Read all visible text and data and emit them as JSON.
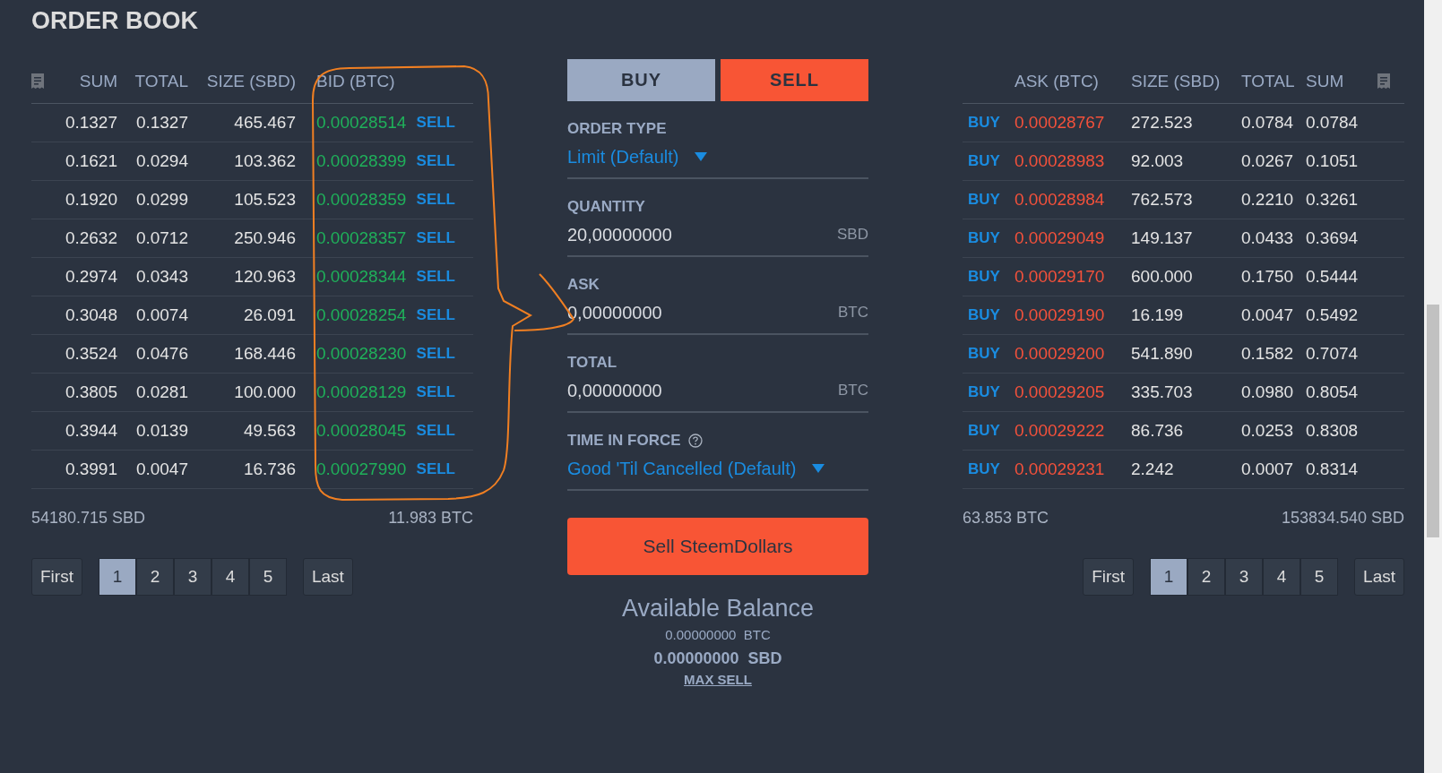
{
  "title": "ORDER BOOK",
  "bids": {
    "columns": [
      "SUM",
      "TOTAL",
      "SIZE (SBD)",
      "BID (BTC)"
    ],
    "rows": [
      {
        "sum": "0.1327",
        "total": "0.1327",
        "size": "465.467",
        "price": "0.00028514",
        "action": "SELL"
      },
      {
        "sum": "0.1621",
        "total": "0.0294",
        "size": "103.362",
        "price": "0.00028399",
        "action": "SELL"
      },
      {
        "sum": "0.1920",
        "total": "0.0299",
        "size": "105.523",
        "price": "0.00028359",
        "action": "SELL"
      },
      {
        "sum": "0.2632",
        "total": "0.0712",
        "size": "250.946",
        "price": "0.00028357",
        "action": "SELL"
      },
      {
        "sum": "0.2974",
        "total": "0.0343",
        "size": "120.963",
        "price": "0.00028344",
        "action": "SELL"
      },
      {
        "sum": "0.3048",
        "total": "0.0074",
        "size": "26.091",
        "price": "0.00028254",
        "action": "SELL"
      },
      {
        "sum": "0.3524",
        "total": "0.0476",
        "size": "168.446",
        "price": "0.00028230",
        "action": "SELL"
      },
      {
        "sum": "0.3805",
        "total": "0.0281",
        "size": "100.000",
        "price": "0.00028129",
        "action": "SELL"
      },
      {
        "sum": "0.3944",
        "total": "0.0139",
        "size": "49.563",
        "price": "0.00028045",
        "action": "SELL"
      },
      {
        "sum": "0.3991",
        "total": "0.0047",
        "size": "16.736",
        "price": "0.00027990",
        "action": "SELL"
      }
    ],
    "footer": [
      "54180.715 SBD",
      "11.983 BTC"
    ],
    "pagination": {
      "first": "First",
      "pages": [
        {
          "label": "1",
          "selected": true
        },
        {
          "label": "2",
          "selected": false
        },
        {
          "label": "3",
          "selected": false
        },
        {
          "label": "4",
          "selected": false
        },
        {
          "label": "5",
          "selected": false
        }
      ],
      "last": "Last"
    }
  },
  "order_form": {
    "tabs": [
      {
        "label": "BUY",
        "selected": false
      },
      {
        "label": "SELL",
        "selected": true
      }
    ],
    "fields": [
      {
        "kind": "select",
        "label": "ORDER TYPE",
        "value": "Limit (Default)",
        "help": false
      },
      {
        "kind": "input",
        "label": "QUANTITY",
        "value": "20,00000000",
        "unit": "SBD",
        "help": false
      },
      {
        "kind": "input",
        "label": "ASK",
        "value": "0,00000000",
        "unit": "BTC",
        "help": false
      },
      {
        "kind": "input",
        "label": "TOTAL",
        "value": "0,00000000",
        "unit": "BTC",
        "help": false
      },
      {
        "kind": "select",
        "label": "TIME IN FORCE",
        "value": "Good 'Til Cancelled (Default)",
        "help": true
      }
    ],
    "submit": "Sell SteemDollars",
    "balance": {
      "title": "Available Balance",
      "lines": [
        {
          "text": "0.00000000  BTC",
          "emphasis": false
        },
        {
          "text": "0.00000000  SBD",
          "emphasis": true
        }
      ],
      "link": "MAX SELL"
    }
  },
  "asks": {
    "columns": [
      "ASK (BTC)",
      "SIZE (SBD)",
      "TOTAL",
      "SUM"
    ],
    "rows": [
      {
        "action": "BUY",
        "price": "0.00028767",
        "size": "272.523",
        "total": "0.0784",
        "sum": "0.0784"
      },
      {
        "action": "BUY",
        "price": "0.00028983",
        "size": "92.003",
        "total": "0.0267",
        "sum": "0.1051"
      },
      {
        "action": "BUY",
        "price": "0.00028984",
        "size": "762.573",
        "total": "0.2210",
        "sum": "0.3261"
      },
      {
        "action": "BUY",
        "price": "0.00029049",
        "size": "149.137",
        "total": "0.0433",
        "sum": "0.3694"
      },
      {
        "action": "BUY",
        "price": "0.00029170",
        "size": "600.000",
        "total": "0.1750",
        "sum": "0.5444"
      },
      {
        "action": "BUY",
        "price": "0.00029190",
        "size": "16.199",
        "total": "0.0047",
        "sum": "0.5492"
      },
      {
        "action": "BUY",
        "price": "0.00029200",
        "size": "541.890",
        "total": "0.1582",
        "sum": "0.7074"
      },
      {
        "action": "BUY",
        "price": "0.00029205",
        "size": "335.703",
        "total": "0.0980",
        "sum": "0.8054"
      },
      {
        "action": "BUY",
        "price": "0.00029222",
        "size": "86.736",
        "total": "0.0253",
        "sum": "0.8308"
      },
      {
        "action": "BUY",
        "price": "0.00029231",
        "size": "2.242",
        "total": "0.0007",
        "sum": "0.8314"
      }
    ],
    "footer": [
      "63.853 BTC",
      "153834.540 SBD"
    ],
    "pagination": {
      "first": "First",
      "pages": [
        {
          "label": "1",
          "selected": true
        },
        {
          "label": "2",
          "selected": false
        },
        {
          "label": "3",
          "selected": false
        },
        {
          "label": "4",
          "selected": false
        },
        {
          "label": "5",
          "selected": false
        }
      ],
      "last": "Last"
    }
  }
}
